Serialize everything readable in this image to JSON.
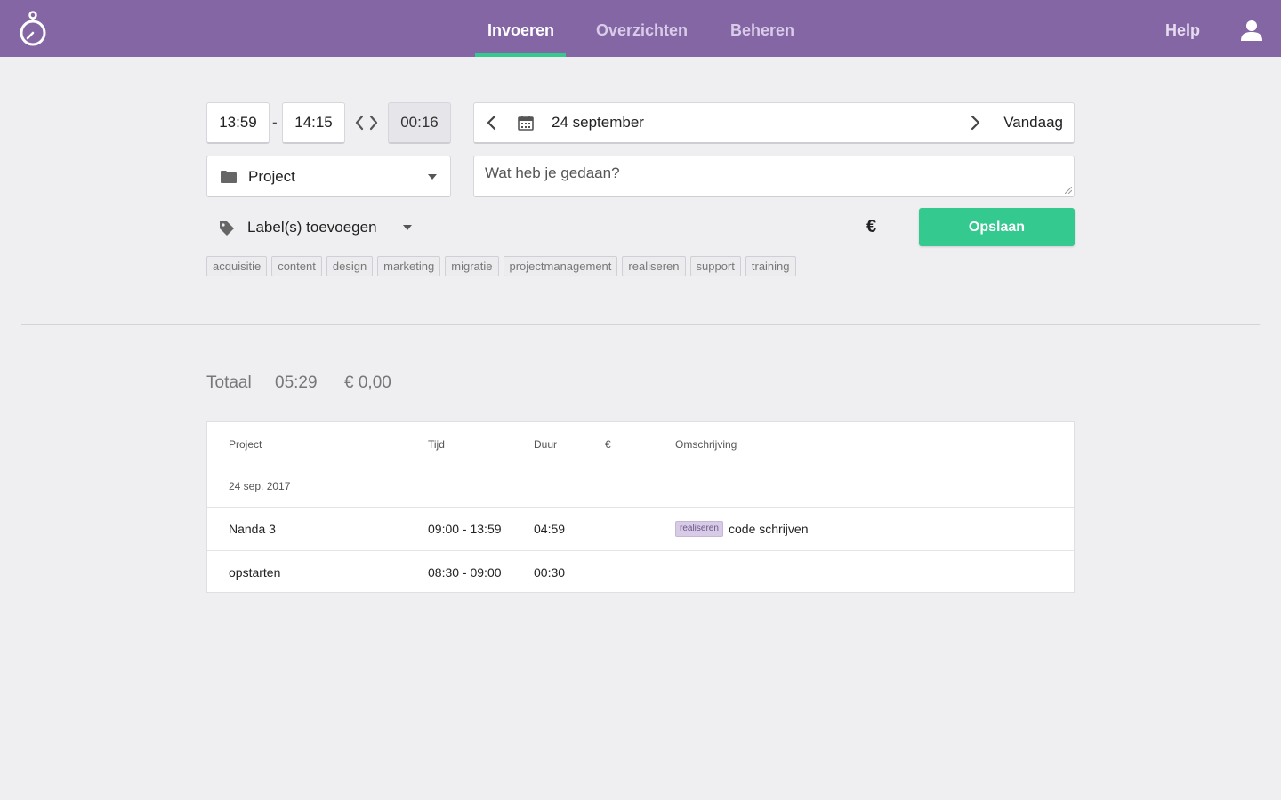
{
  "colors": {
    "header_bg": "#8466a5",
    "accent_green": "#34c98e",
    "page_bg": "#efeff2",
    "label_bg": "#d7cbe6"
  },
  "nav": {
    "items": [
      {
        "label": "Invoeren",
        "active": true
      },
      {
        "label": "Overzichten",
        "active": false
      },
      {
        "label": "Beheren",
        "active": false
      }
    ],
    "help": "Help",
    "logo_icon": "stopwatch-icon",
    "user_icon": "user-icon"
  },
  "entry": {
    "start_time": "13:59",
    "separator": "-",
    "end_time": "14:15",
    "duration": "00:16",
    "date": "24 september",
    "today_label": "Vandaag",
    "project_placeholder": "Project",
    "description_placeholder": "Wat heb je gedaan?",
    "labels_placeholder": "Label(s) toevoegen",
    "currency_symbol": "€",
    "save_label": "Opslaan"
  },
  "label_chips": [
    "acquisitie",
    "content",
    "design",
    "marketing",
    "migratie",
    "projectmanagement",
    "realiseren",
    "support",
    "training"
  ],
  "totals": {
    "label": "Totaal",
    "time": "05:29",
    "amount": "€ 0,00"
  },
  "table": {
    "headers": {
      "project": "Project",
      "time": "Tijd",
      "duration": "Duur",
      "amount": "€",
      "description": "Omschrijving"
    },
    "group_date": "24 sep. 2017",
    "rows": [
      {
        "project": "Nanda 3",
        "time": "09:00 - 13:59",
        "duration": "04:59",
        "amount": "",
        "label": "realiseren",
        "description": "code schrijven"
      },
      {
        "project": "opstarten",
        "time": "08:30 - 09:00",
        "duration": "00:30",
        "amount": "",
        "label": "",
        "description": ""
      }
    ]
  }
}
